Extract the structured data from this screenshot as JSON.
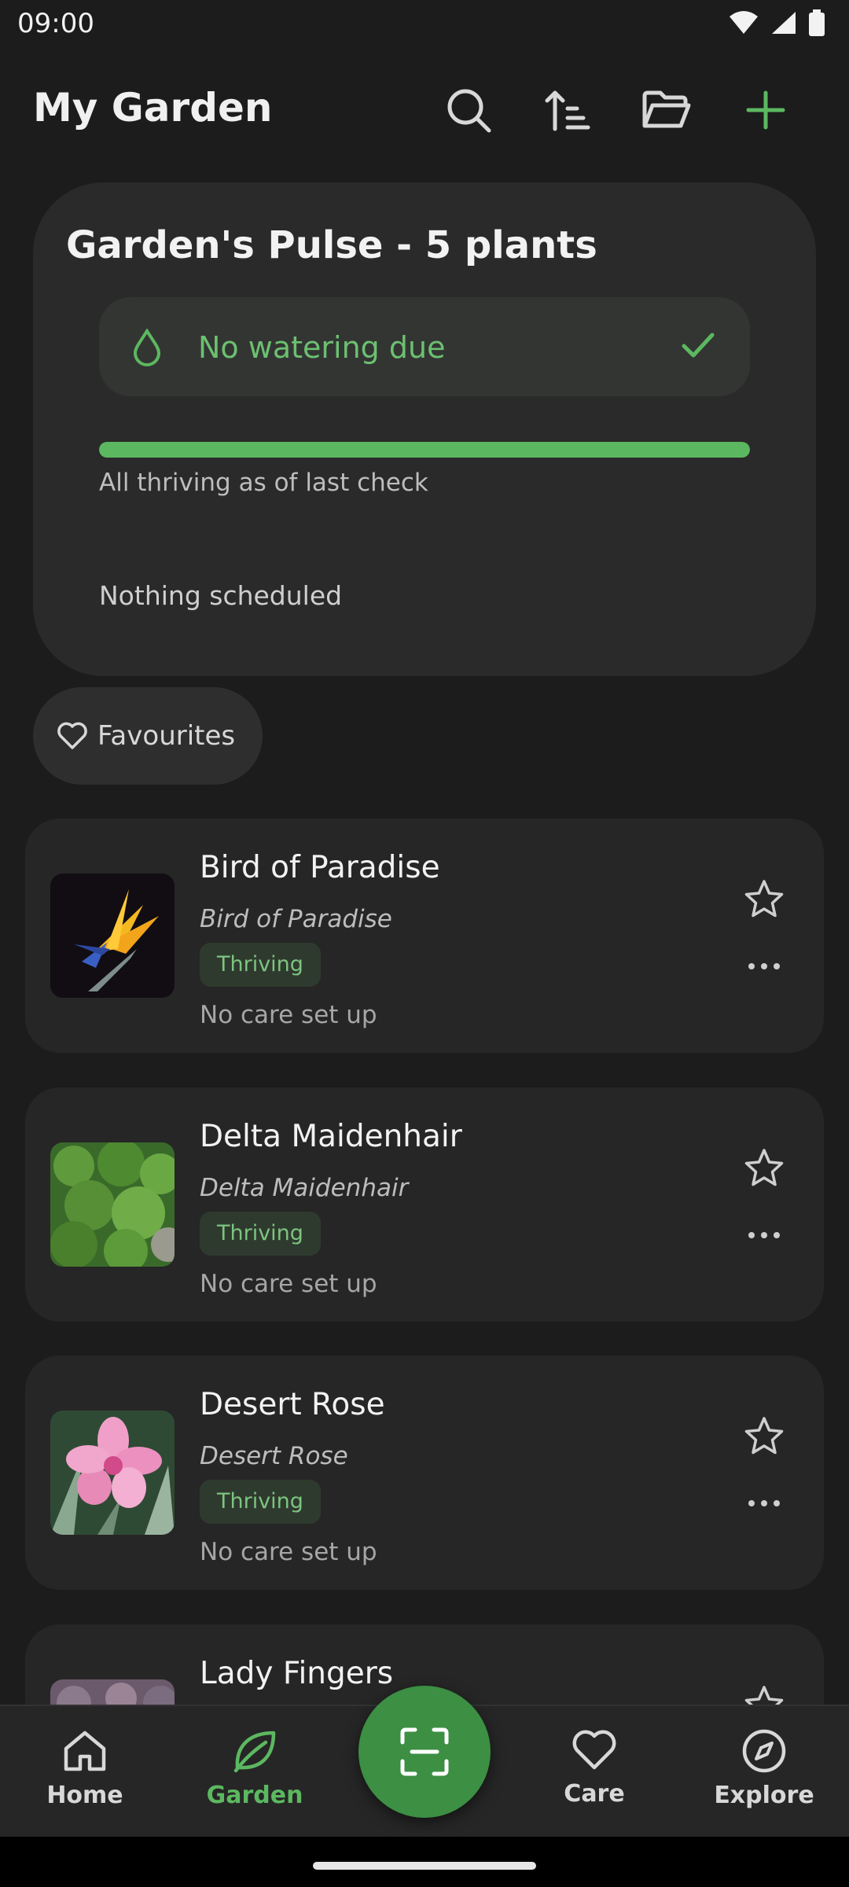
{
  "status_bar": {
    "time": "09:00"
  },
  "header": {
    "title": "My Garden",
    "actions": [
      {
        "icon": "search-icon"
      },
      {
        "icon": "sort-icon"
      },
      {
        "icon": "folder-icon"
      },
      {
        "icon": "plus-icon"
      }
    ]
  },
  "pulse": {
    "title": "Garden's Pulse - 5 plants",
    "watering": "No watering due",
    "health_progress": 1.0,
    "health_note": "All thriving as of last check",
    "schedule_note": "Nothing scheduled"
  },
  "filters": {
    "favourites_label": "Favourites"
  },
  "plants": [
    {
      "name": "Bird of Paradise",
      "scientific": "Bird of Paradise",
      "status": "Thriving",
      "care": "No care set up"
    },
    {
      "name": "Delta Maidenhair",
      "scientific": "Delta Maidenhair",
      "status": "Thriving",
      "care": "No care set up"
    },
    {
      "name": "Desert Rose",
      "scientific": "Desert Rose",
      "status": "Thriving",
      "care": "No care set up"
    },
    {
      "name": "Lady Fingers",
      "scientific": "",
      "status": "",
      "care": ""
    }
  ],
  "nav": {
    "items": [
      {
        "label": "Home",
        "icon": "home-icon"
      },
      {
        "label": "Garden",
        "icon": "leaf-icon",
        "active": true
      },
      {
        "label": "Care",
        "icon": "heart-icon"
      },
      {
        "label": "Explore",
        "icon": "compass-icon"
      }
    ],
    "scan_icon": "scan-icon"
  },
  "colors": {
    "accent": "#5cb860",
    "fab": "#3c8f43",
    "background": "#1c1c1c",
    "card": "#2a2a2a"
  }
}
